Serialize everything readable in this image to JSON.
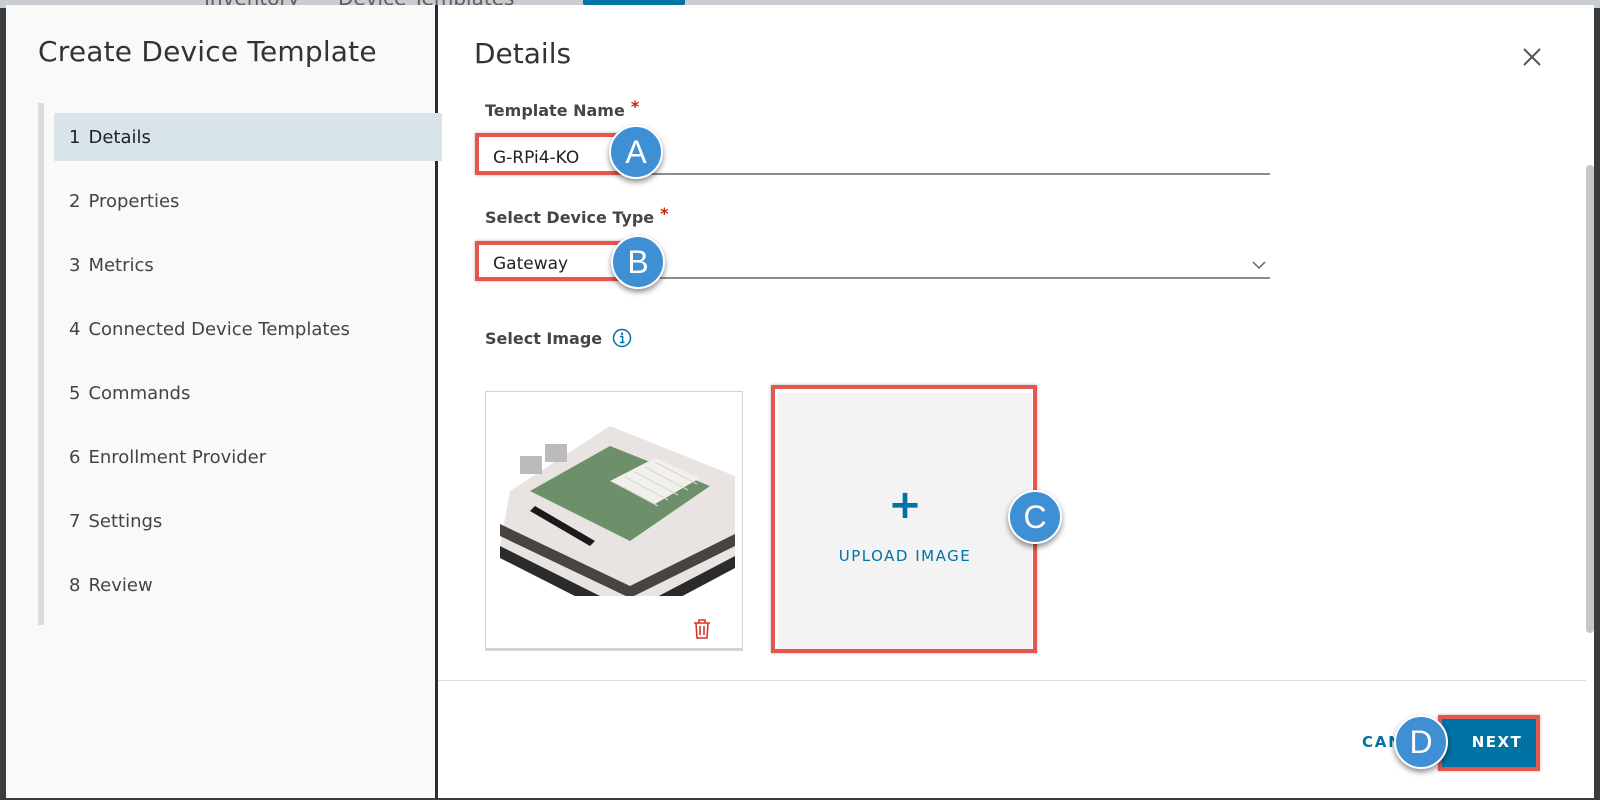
{
  "backdrop": {
    "tab1": "Inventory",
    "tab2": "Device Templates"
  },
  "sidebar": {
    "title": "Create Device Template",
    "steps": [
      {
        "num": "1",
        "label": "Details"
      },
      {
        "num": "2",
        "label": "Properties"
      },
      {
        "num": "3",
        "label": "Metrics"
      },
      {
        "num": "4",
        "label": "Connected Device Templates"
      },
      {
        "num": "5",
        "label": "Commands"
      },
      {
        "num": "6",
        "label": "Enrollment Provider"
      },
      {
        "num": "7",
        "label": "Settings"
      },
      {
        "num": "8",
        "label": "Review"
      }
    ],
    "active_step": "1"
  },
  "main": {
    "title": "Details",
    "template_name": {
      "label": "Template Name",
      "required": "*",
      "value": "G-RPi4-KO"
    },
    "device_type": {
      "label": "Select Device Type",
      "required": "*",
      "value": "Gateway"
    },
    "select_image": {
      "label": "Select Image"
    },
    "upload": {
      "plus": "+",
      "label": "UPLOAD IMAGE"
    }
  },
  "footer": {
    "cancel_label": "CANCEL",
    "next_label": "NEXT"
  },
  "callouts": {
    "a": "A",
    "b": "B",
    "c": "C",
    "d": "D"
  },
  "colors": {
    "accent": "#0072a3",
    "highlight": "#e5574e",
    "badge": "#3e8fd4",
    "required": "#c92100"
  }
}
